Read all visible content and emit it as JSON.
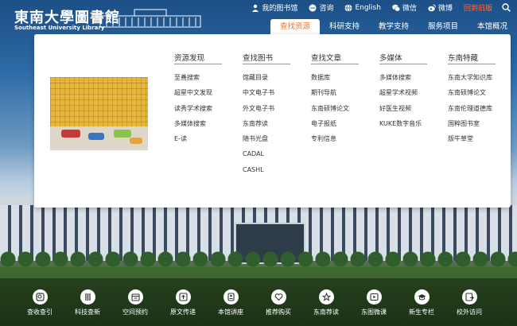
{
  "brand": {
    "name_cn": "東南大學圖書館",
    "name_en": "Southeast University Library"
  },
  "toplinks": [
    {
      "label": "我的图书馆",
      "icon": "user-icon"
    },
    {
      "label": "咨询",
      "icon": "chat-icon"
    },
    {
      "label": "English",
      "icon": "globe-icon"
    },
    {
      "label": "微信",
      "icon": "wechat-icon"
    },
    {
      "label": "微博",
      "icon": "weibo-icon"
    },
    {
      "label": "回到旧版",
      "icon": ""
    }
  ],
  "nav": [
    {
      "label": "查找资源",
      "active": true
    },
    {
      "label": "科研支持",
      "active": false
    },
    {
      "label": "教学支持",
      "active": false
    },
    {
      "label": "服务项目",
      "active": false
    },
    {
      "label": "本馆概况",
      "active": false
    }
  ],
  "menu": [
    {
      "title": "资源发现",
      "items": [
        "至善搜索",
        "超星中文发现",
        "读秀学术搜索",
        "多媒体搜索",
        "E-读"
      ]
    },
    {
      "title": "查找图书",
      "items": [
        "馆藏目录",
        "中文电子书",
        "外文电子书",
        "东南荐读",
        "随书光盘",
        "CADAL",
        "CASHL"
      ]
    },
    {
      "title": "查找文章",
      "items": [
        "数据库",
        "期刊导航",
        "东南硕博论文",
        "电子报纸",
        "专利信息"
      ]
    },
    {
      "title": "多媒体",
      "items": [
        "多媒体搜索",
        "超星学术视频",
        "好医生视频",
        "KUKE数字音乐"
      ]
    },
    {
      "title": "东南特藏",
      "items": [
        "东南大学知识库",
        "东南硕博论文",
        "东南伦理道德库",
        "国粹图书室",
        "版牛草堂"
      ]
    }
  ],
  "dock": [
    {
      "label": "查收查引",
      "icon": "search-doc-icon"
    },
    {
      "label": "科技查新",
      "icon": "tools-icon"
    },
    {
      "label": "空间预约",
      "icon": "calendar-icon"
    },
    {
      "label": "原文传递",
      "icon": "upload-icon"
    },
    {
      "label": "本馆讲座",
      "icon": "lecture-icon"
    },
    {
      "label": "推荐购买",
      "icon": "heart-icon"
    },
    {
      "label": "东南荐读",
      "icon": "star-icon"
    },
    {
      "label": "东图微课",
      "icon": "play-icon"
    },
    {
      "label": "新生专栏",
      "icon": "graduation-cap-icon"
    },
    {
      "label": "校外访问",
      "icon": "external-access-icon"
    }
  ],
  "colors": {
    "accent": "#e8772e",
    "old_version": "#ff6a3d",
    "panel_bg": "#ffffff"
  }
}
